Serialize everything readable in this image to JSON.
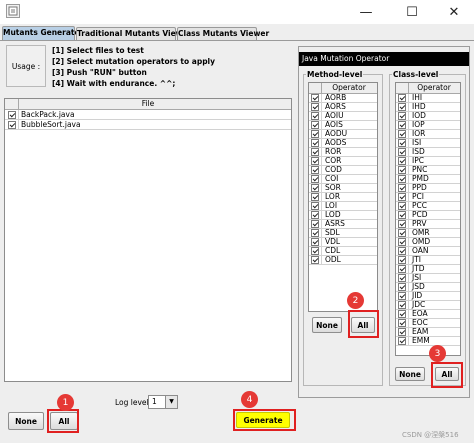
{
  "window": {
    "minimize_glyph": "—",
    "maximize_glyph": "☐",
    "close_glyph": "✕"
  },
  "tabs": [
    {
      "label": "Mutants Generator"
    },
    {
      "label": "Traditional Mutants Viewer"
    },
    {
      "label": "Class Mutants Viewer"
    }
  ],
  "usage": {
    "label": "Usage :",
    "steps": [
      "[1] Select files to test",
      "[2] Select mutation operators to apply",
      "[3] Push \"RUN\" button",
      "[4] Wait with endurance. ^^;"
    ]
  },
  "files": {
    "header": "File",
    "rows": [
      {
        "name": "BackPack.java",
        "checked": true
      },
      {
        "name": "BubbleSort.java",
        "checked": true
      }
    ]
  },
  "operator_panel": {
    "title": "Java Mutation Operator"
  },
  "method_level": {
    "label": "Method-level",
    "header": "Operator",
    "ops": [
      "AORB",
      "AORS",
      "AOIU",
      "AOIS",
      "AODU",
      "AODS",
      "ROR",
      "COR",
      "COD",
      "COI",
      "SOR",
      "LOR",
      "LOI",
      "LOD",
      "ASRS",
      "SDL",
      "VDL",
      "CDL",
      "ODL"
    ],
    "none_label": "None",
    "all_label": "All"
  },
  "class_level": {
    "label": "Class-level",
    "header": "Operator",
    "ops": [
      "IHI",
      "IHD",
      "IOD",
      "IOP",
      "IOR",
      "ISI",
      "ISD",
      "IPC",
      "PNC",
      "PMD",
      "PPD",
      "PCI",
      "PCC",
      "PCD",
      "PRV",
      "OMR",
      "OMD",
      "OAN",
      "JTI",
      "JTD",
      "JSI",
      "JSD",
      "JID",
      "JDC",
      "EOA",
      "EOC",
      "EAM",
      "EMM"
    ],
    "none_label": "None",
    "all_label": "All"
  },
  "bottom": {
    "none_label": "None",
    "all_label": "All",
    "log_level_label": "Log level",
    "log_level_value": "1",
    "dropdown_glyph": "▼",
    "generate_label": "Generate"
  },
  "annotations": [
    "1",
    "2",
    "3",
    "4"
  ],
  "watermark": "CSDN @涅槃516",
  "colors": {
    "selected_tab": "#b8cfe5",
    "panel_title_bg": "#000000",
    "generate_bg": "#ffff00",
    "annotation_red": "#e53935"
  }
}
